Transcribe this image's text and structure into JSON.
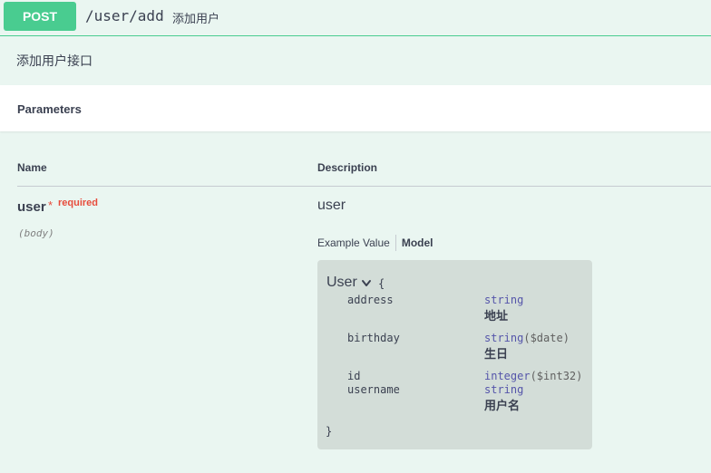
{
  "operation": {
    "method": "POST",
    "path": "/user/add",
    "summary": "添加用户",
    "description": "添加用户接口"
  },
  "parameters": {
    "title": "Parameters",
    "columns": {
      "name": "Name",
      "description": "Description"
    },
    "items": [
      {
        "name": "user",
        "required_star": "*",
        "required_label": "required",
        "in": "(body)",
        "description": "user",
        "tabs": {
          "example": "Example Value",
          "model": "Model"
        },
        "model": {
          "title": "User",
          "open_brace": "{",
          "close_brace": "}",
          "properties": [
            {
              "name": "address",
              "type": "string",
              "format": "",
              "description": "地址"
            },
            {
              "name": "birthday",
              "type": "string",
              "format": "($date)",
              "description": "生日"
            },
            {
              "name": "id",
              "type": "integer",
              "format": "($int32)",
              "description": ""
            },
            {
              "name": "username",
              "type": "string",
              "format": "",
              "description": "用户名"
            }
          ]
        }
      }
    ]
  },
  "colors": {
    "post": "#49cc90",
    "background": "#eaf6f1",
    "required": "#e74c3c",
    "model_bg": "#d3ddd8",
    "type": "#5555aa"
  },
  "icons": {
    "collapse": "chevron-down-icon"
  }
}
